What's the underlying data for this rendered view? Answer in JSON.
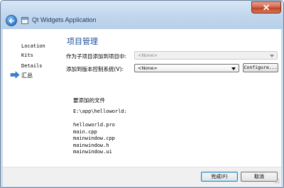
{
  "window": {
    "title": "Qt Widgets Application"
  },
  "sidebar": {
    "items": [
      {
        "label": "Location"
      },
      {
        "label": "Kits"
      },
      {
        "label": "Details"
      },
      {
        "label": "汇总"
      }
    ],
    "active_index": 3
  },
  "page": {
    "title": "项目管理",
    "subproject_label": "作为子项目添加到项目中:",
    "subproject_value": "<None>",
    "vcs_label": "添加到版本控制系统(V):",
    "vcs_value": "<None>",
    "configure_label": "Configure..."
  },
  "files": {
    "heading": "要添加的文件",
    "path": "E:\\app\\helloworld:",
    "list": [
      "helloworld.pro",
      "main.cpp",
      "mainwindow.cpp",
      "mainwindow.h",
      "mainwindow.ui"
    ]
  },
  "buttons": {
    "finish_label": "完成(F)",
    "cancel_label": "取消"
  },
  "colors": {
    "title_accent": "#1a4e9c",
    "frame": "#c9dcef",
    "close_red": "#c4432a"
  },
  "icons": {
    "back": "back-arrow-icon",
    "close": "close-icon",
    "app": "app-window-icon",
    "active_step": "arrow-right-icon"
  }
}
